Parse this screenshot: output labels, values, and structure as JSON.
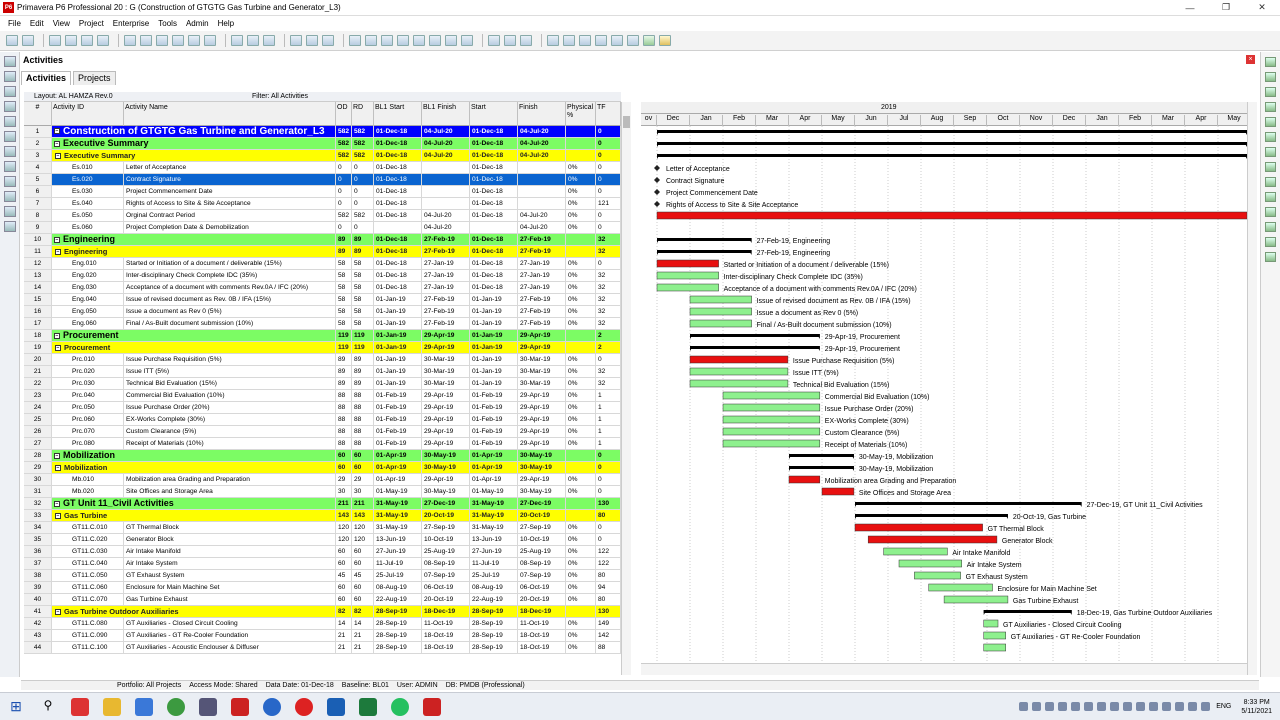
{
  "window": {
    "title": "Primavera P6 Professional 20 : G (Construction of GTGTG Gas Turbine and Generator_L3)",
    "app_icon": "P6"
  },
  "menu": [
    "File",
    "Edit",
    "View",
    "Project",
    "Enterprise",
    "Tools",
    "Admin",
    "Help"
  ],
  "panel": {
    "title": "Activities",
    "tabs": [
      "Activities",
      "Projects"
    ]
  },
  "layout_bar": {
    "layout": "Layout: AL HAMZA Rev.0",
    "filter": "Filter: All Activities"
  },
  "columns": [
    "#",
    "Activity ID",
    "Activity Name",
    "OD",
    "RD",
    "BL1 Start",
    "BL1 Finish",
    "Start",
    "Finish",
    "Physical %",
    "TF"
  ],
  "rows": [
    {
      "n": "1",
      "id": "Construction of GTGTG Gas Turbine and Generator_L3",
      "name": "",
      "od": "582",
      "rd": "582",
      "bs": "01-Dec-18",
      "bf": "04-Jul-20",
      "s": "01-Dec-18",
      "f": "04-Jul-20",
      "p": "",
      "tf": "0",
      "lvl": "lvl1"
    },
    {
      "n": "2",
      "id": "Executive Summary",
      "name": "",
      "od": "582",
      "rd": "582",
      "bs": "01-Dec-18",
      "bf": "04-Jul-20",
      "s": "01-Dec-18",
      "f": "04-Jul-20",
      "p": "",
      "tf": "0",
      "lvl": "lvl2"
    },
    {
      "n": "3",
      "id": "Executive Summary",
      "name": "",
      "od": "582",
      "rd": "582",
      "bs": "01-Dec-18",
      "bf": "04-Jul-20",
      "s": "01-Dec-18",
      "f": "04-Jul-20",
      "p": "",
      "tf": "0",
      "lvl": "lvl3"
    },
    {
      "n": "4",
      "id": "Es.010",
      "name": "Letter of Acceptance",
      "od": "0",
      "rd": "0",
      "bs": "01-Dec-18",
      "bf": "",
      "s": "01-Dec-18",
      "f": "",
      "p": "0%",
      "tf": "0",
      "lvl": "act"
    },
    {
      "n": "5",
      "id": "Es.020",
      "name": "Contract Signature",
      "od": "0",
      "rd": "0",
      "bs": "01-Dec-18",
      "bf": "",
      "s": "01-Dec-18",
      "f": "",
      "p": "0%",
      "tf": "0",
      "lvl": "sel"
    },
    {
      "n": "6",
      "id": "Es.030",
      "name": "Project Commencement Date",
      "od": "0",
      "rd": "0",
      "bs": "01-Dec-18",
      "bf": "",
      "s": "01-Dec-18",
      "f": "",
      "p": "0%",
      "tf": "0",
      "lvl": "act"
    },
    {
      "n": "7",
      "id": "Es.040",
      "name": "Rights of Access to Site & Site Acceptance",
      "od": "0",
      "rd": "0",
      "bs": "01-Dec-18",
      "bf": "",
      "s": "01-Dec-18",
      "f": "",
      "p": "0%",
      "tf": "121",
      "lvl": "act"
    },
    {
      "n": "8",
      "id": "Es.050",
      "name": "Orginal Contract Period",
      "od": "582",
      "rd": "582",
      "bs": "01-Dec-18",
      "bf": "04-Jul-20",
      "s": "01-Dec-18",
      "f": "04-Jul-20",
      "p": "0%",
      "tf": "0",
      "lvl": "act"
    },
    {
      "n": "9",
      "id": "Es.060",
      "name": "Project Completion Date & Demobilization",
      "od": "0",
      "rd": "0",
      "bs": "",
      "bf": "04-Jul-20",
      "s": "",
      "f": "04-Jul-20",
      "p": "0%",
      "tf": "0",
      "lvl": "act"
    },
    {
      "n": "10",
      "id": "Engineering",
      "name": "",
      "od": "89",
      "rd": "89",
      "bs": "01-Dec-18",
      "bf": "27-Feb-19",
      "s": "01-Dec-18",
      "f": "27-Feb-19",
      "p": "",
      "tf": "32",
      "lvl": "lvl2"
    },
    {
      "n": "11",
      "id": "Engineering",
      "name": "",
      "od": "89",
      "rd": "89",
      "bs": "01-Dec-18",
      "bf": "27-Feb-19",
      "s": "01-Dec-18",
      "f": "27-Feb-19",
      "p": "",
      "tf": "32",
      "lvl": "lvl3"
    },
    {
      "n": "12",
      "id": "Eng.010",
      "name": "Started or Initiation of a document / deliverable (15%)",
      "od": "58",
      "rd": "58",
      "bs": "01-Dec-18",
      "bf": "27-Jan-19",
      "s": "01-Dec-18",
      "f": "27-Jan-19",
      "p": "0%",
      "tf": "0",
      "lvl": "act"
    },
    {
      "n": "13",
      "id": "Eng.020",
      "name": "Inter-disciplinary Check Complete IDC (35%)",
      "od": "58",
      "rd": "58",
      "bs": "01-Dec-18",
      "bf": "27-Jan-19",
      "s": "01-Dec-18",
      "f": "27-Jan-19",
      "p": "0%",
      "tf": "32",
      "lvl": "act"
    },
    {
      "n": "14",
      "id": "Eng.030",
      "name": "Acceptance of a document with comments Rev.0A / IFC (20%)",
      "od": "58",
      "rd": "58",
      "bs": "01-Dec-18",
      "bf": "27-Jan-19",
      "s": "01-Dec-18",
      "f": "27-Jan-19",
      "p": "0%",
      "tf": "32",
      "lvl": "act"
    },
    {
      "n": "15",
      "id": "Eng.040",
      "name": "Issue of revised document as Rev. 0B / IFA (15%)",
      "od": "58",
      "rd": "58",
      "bs": "01-Jan-19",
      "bf": "27-Feb-19",
      "s": "01-Jan-19",
      "f": "27-Feb-19",
      "p": "0%",
      "tf": "32",
      "lvl": "act"
    },
    {
      "n": "16",
      "id": "Eng.050",
      "name": "Issue a document as Rev 0 (5%)",
      "od": "58",
      "rd": "58",
      "bs": "01-Jan-19",
      "bf": "27-Feb-19",
      "s": "01-Jan-19",
      "f": "27-Feb-19",
      "p": "0%",
      "tf": "32",
      "lvl": "act"
    },
    {
      "n": "17",
      "id": "Eng.060",
      "name": "Final / As-Built document submission (10%)",
      "od": "58",
      "rd": "58",
      "bs": "01-Jan-19",
      "bf": "27-Feb-19",
      "s": "01-Jan-19",
      "f": "27-Feb-19",
      "p": "0%",
      "tf": "32",
      "lvl": "act"
    },
    {
      "n": "18",
      "id": "Procurement",
      "name": "",
      "od": "119",
      "rd": "119",
      "bs": "01-Jan-19",
      "bf": "29-Apr-19",
      "s": "01-Jan-19",
      "f": "29-Apr-19",
      "p": "",
      "tf": "2",
      "lvl": "lvl2"
    },
    {
      "n": "19",
      "id": "Procurement",
      "name": "",
      "od": "119",
      "rd": "119",
      "bs": "01-Jan-19",
      "bf": "29-Apr-19",
      "s": "01-Jan-19",
      "f": "29-Apr-19",
      "p": "",
      "tf": "2",
      "lvl": "lvl3"
    },
    {
      "n": "20",
      "id": "Prc.010",
      "name": "Issue Purchase Requisition (5%)",
      "od": "89",
      "rd": "89",
      "bs": "01-Jan-19",
      "bf": "30-Mar-19",
      "s": "01-Jan-19",
      "f": "30-Mar-19",
      "p": "0%",
      "tf": "0",
      "lvl": "act"
    },
    {
      "n": "21",
      "id": "Prc.020",
      "name": "Issue ITT (5%)",
      "od": "89",
      "rd": "89",
      "bs": "01-Jan-19",
      "bf": "30-Mar-19",
      "s": "01-Jan-19",
      "f": "30-Mar-19",
      "p": "0%",
      "tf": "32",
      "lvl": "act"
    },
    {
      "n": "22",
      "id": "Prc.030",
      "name": "Technical Bid Evaluation (15%)",
      "od": "89",
      "rd": "89",
      "bs": "01-Jan-19",
      "bf": "30-Mar-19",
      "s": "01-Jan-19",
      "f": "30-Mar-19",
      "p": "0%",
      "tf": "32",
      "lvl": "act"
    },
    {
      "n": "23",
      "id": "Prc.040",
      "name": "Commercial Bid Evaluation (10%)",
      "od": "88",
      "rd": "88",
      "bs": "01-Feb-19",
      "bf": "29-Apr-19",
      "s": "01-Feb-19",
      "f": "29-Apr-19",
      "p": "0%",
      "tf": "1",
      "lvl": "act"
    },
    {
      "n": "24",
      "id": "Prc.050",
      "name": "Issue Purchase Order (20%)",
      "od": "88",
      "rd": "88",
      "bs": "01-Feb-19",
      "bf": "29-Apr-19",
      "s": "01-Feb-19",
      "f": "29-Apr-19",
      "p": "0%",
      "tf": "1",
      "lvl": "act"
    },
    {
      "n": "25",
      "id": "Prc.060",
      "name": "EX-Works Complete (30%)",
      "od": "88",
      "rd": "88",
      "bs": "01-Feb-19",
      "bf": "29-Apr-19",
      "s": "01-Feb-19",
      "f": "29-Apr-19",
      "p": "0%",
      "tf": "1",
      "lvl": "act"
    },
    {
      "n": "26",
      "id": "Prc.070",
      "name": "Custom Clearance (5%)",
      "od": "88",
      "rd": "88",
      "bs": "01-Feb-19",
      "bf": "29-Apr-19",
      "s": "01-Feb-19",
      "f": "29-Apr-19",
      "p": "0%",
      "tf": "1",
      "lvl": "act"
    },
    {
      "n": "27",
      "id": "Prc.080",
      "name": "Receipt of Materials (10%)",
      "od": "88",
      "rd": "88",
      "bs": "01-Feb-19",
      "bf": "29-Apr-19",
      "s": "01-Feb-19",
      "f": "29-Apr-19",
      "p": "0%",
      "tf": "1",
      "lvl": "act"
    },
    {
      "n": "28",
      "id": "Mobilization",
      "name": "",
      "od": "60",
      "rd": "60",
      "bs": "01-Apr-19",
      "bf": "30-May-19",
      "s": "01-Apr-19",
      "f": "30-May-19",
      "p": "",
      "tf": "0",
      "lvl": "lvl2"
    },
    {
      "n": "29",
      "id": "Mobilization",
      "name": "",
      "od": "60",
      "rd": "60",
      "bs": "01-Apr-19",
      "bf": "30-May-19",
      "s": "01-Apr-19",
      "f": "30-May-19",
      "p": "",
      "tf": "0",
      "lvl": "lvl3"
    },
    {
      "n": "30",
      "id": "Mb.010",
      "name": "Mobilization area Grading and Preparation",
      "od": "29",
      "rd": "29",
      "bs": "01-Apr-19",
      "bf": "29-Apr-19",
      "s": "01-Apr-19",
      "f": "29-Apr-19",
      "p": "0%",
      "tf": "0",
      "lvl": "act"
    },
    {
      "n": "31",
      "id": "Mb.020",
      "name": "Site Offices and Storage Area",
      "od": "30",
      "rd": "30",
      "bs": "01-May-19",
      "bf": "30-May-19",
      "s": "01-May-19",
      "f": "30-May-19",
      "p": "0%",
      "tf": "0",
      "lvl": "act"
    },
    {
      "n": "32",
      "id": "GT Unit 11_Civil Activities",
      "name": "",
      "od": "211",
      "rd": "211",
      "bs": "31-May-19",
      "bf": "27-Dec-19",
      "s": "31-May-19",
      "f": "27-Dec-19",
      "p": "",
      "tf": "130",
      "lvl": "lvl2"
    },
    {
      "n": "33",
      "id": "Gas Turbine",
      "name": "",
      "od": "143",
      "rd": "143",
      "bs": "31-May-19",
      "bf": "20-Oct-19",
      "s": "31-May-19",
      "f": "20-Oct-19",
      "p": "",
      "tf": "80",
      "lvl": "lvl3"
    },
    {
      "n": "34",
      "id": "GT11.C.010",
      "name": "GT Thermal Block",
      "od": "120",
      "rd": "120",
      "bs": "31-May-19",
      "bf": "27-Sep-19",
      "s": "31-May-19",
      "f": "27-Sep-19",
      "p": "0%",
      "tf": "0",
      "lvl": "act"
    },
    {
      "n": "35",
      "id": "GT11.C.020",
      "name": "Generator Block",
      "od": "120",
      "rd": "120",
      "bs": "13-Jun-19",
      "bf": "10-Oct-19",
      "s": "13-Jun-19",
      "f": "10-Oct-19",
      "p": "0%",
      "tf": "0",
      "lvl": "act"
    },
    {
      "n": "36",
      "id": "GT11.C.030",
      "name": "Air Intake Manifold",
      "od": "60",
      "rd": "60",
      "bs": "27-Jun-19",
      "bf": "25-Aug-19",
      "s": "27-Jun-19",
      "f": "25-Aug-19",
      "p": "0%",
      "tf": "122",
      "lvl": "act"
    },
    {
      "n": "37",
      "id": "GT11.C.040",
      "name": "Air Intake System",
      "od": "60",
      "rd": "60",
      "bs": "11-Jul-19",
      "bf": "08-Sep-19",
      "s": "11-Jul-19",
      "f": "08-Sep-19",
      "p": "0%",
      "tf": "122",
      "lvl": "act"
    },
    {
      "n": "38",
      "id": "GT11.C.050",
      "name": "GT Exhaust System",
      "od": "45",
      "rd": "45",
      "bs": "25-Jul-19",
      "bf": "07-Sep-19",
      "s": "25-Jul-19",
      "f": "07-Sep-19",
      "p": "0%",
      "tf": "80",
      "lvl": "act"
    },
    {
      "n": "39",
      "id": "GT11.C.060",
      "name": "Enclosure for Main Machine Set",
      "od": "60",
      "rd": "60",
      "bs": "08-Aug-19",
      "bf": "06-Oct-19",
      "s": "08-Aug-19",
      "f": "06-Oct-19",
      "p": "0%",
      "tf": "94",
      "lvl": "act"
    },
    {
      "n": "40",
      "id": "GT11.C.070",
      "name": "Gas Turbine Exhaust",
      "od": "60",
      "rd": "60",
      "bs": "22-Aug-19",
      "bf": "20-Oct-19",
      "s": "22-Aug-19",
      "f": "20-Oct-19",
      "p": "0%",
      "tf": "80",
      "lvl": "act"
    },
    {
      "n": "41",
      "id": "Gas Turbine Outdoor Auxiliaries",
      "name": "",
      "od": "82",
      "rd": "82",
      "bs": "28-Sep-19",
      "bf": "18-Dec-19",
      "s": "28-Sep-19",
      "f": "18-Dec-19",
      "p": "",
      "tf": "130",
      "lvl": "lvl3"
    },
    {
      "n": "42",
      "id": "GT11.C.080",
      "name": "GT Auxiliaries - Closed Circuit Cooling",
      "od": "14",
      "rd": "14",
      "bs": "28-Sep-19",
      "bf": "11-Oct-19",
      "s": "28-Sep-19",
      "f": "11-Oct-19",
      "p": "0%",
      "tf": "149",
      "lvl": "act"
    },
    {
      "n": "43",
      "id": "GT11.C.090",
      "name": "GT Auxiliaries - GT Re-Cooler Foundation",
      "od": "21",
      "rd": "21",
      "bs": "28-Sep-19",
      "bf": "18-Oct-19",
      "s": "28-Sep-19",
      "f": "18-Oct-19",
      "p": "0%",
      "tf": "142",
      "lvl": "act"
    },
    {
      "n": "44",
      "id": "GT11.C.100",
      "name": "GT Auxiliaries - Acoustic Enclouser & Diffuser",
      "od": "21",
      "rd": "21",
      "bs": "28-Sep-19",
      "bf": "18-Oct-19",
      "s": "28-Sep-19",
      "f": "18-Oct-19",
      "p": "0%",
      "tf": "88",
      "lvl": "act"
    }
  ],
  "gantt": {
    "year_label": "2019",
    "months": [
      "ov",
      "Dec",
      "Jan",
      "Feb",
      "Mar",
      "Apr",
      "May",
      "Jun",
      "Jul",
      "Aug",
      "Sep",
      "Oct",
      "Nov",
      "Dec",
      "Jan",
      "Feb",
      "Mar",
      "Apr",
      "May"
    ],
    "labels": [
      {
        "row": 4,
        "text": "Letter of Acceptance"
      },
      {
        "row": 5,
        "text": "Contract Signature"
      },
      {
        "row": 6,
        "text": "Project Commencement Date"
      },
      {
        "row": 7,
        "text": "Rights of Access to Site & Site Acceptance"
      },
      {
        "row": 10,
        "text": "27-Feb-19, Engineering"
      },
      {
        "row": 11,
        "text": "27-Feb-19, Engineering"
      },
      {
        "row": 12,
        "text": "Started or Initiation of a document / deliverable (15%)"
      },
      {
        "row": 13,
        "text": "Inter-disciplinary Check Complete IDC (35%)"
      },
      {
        "row": 14,
        "text": "Acceptance of a document with comments Rev.0A / IFC (20%)"
      },
      {
        "row": 15,
        "text": "Issue of revised document as Rev. 0B / IFA (15%)"
      },
      {
        "row": 16,
        "text": "Issue a document as Rev 0 (5%)"
      },
      {
        "row": 17,
        "text": "Final / As-Built document submission (10%)"
      },
      {
        "row": 18,
        "text": "29-Apr-19, Procurement"
      },
      {
        "row": 19,
        "text": "29-Apr-19, Procurement"
      },
      {
        "row": 20,
        "text": "Issue Purchase Requisition (5%)"
      },
      {
        "row": 21,
        "text": "Issue ITT (5%)"
      },
      {
        "row": 22,
        "text": "Technical Bid Evaluation (15%)"
      },
      {
        "row": 23,
        "text": "Commercial Bid Evaluation (10%)"
      },
      {
        "row": 24,
        "text": "Issue Purchase Order (20%)"
      },
      {
        "row": 25,
        "text": "EX-Works Complete (30%)"
      },
      {
        "row": 26,
        "text": "Custom Clearance (5%)"
      },
      {
        "row": 27,
        "text": "Receipt of Materials (10%)"
      },
      {
        "row": 28,
        "text": "30-May-19, Mobilization"
      },
      {
        "row": 29,
        "text": "30-May-19, Mobilization"
      },
      {
        "row": 30,
        "text": "Mobilization area Grading and Preparation"
      },
      {
        "row": 31,
        "text": "Site Offices and Storage Area"
      },
      {
        "row": 32,
        "text": "27-Dec-19, GT Unit 11_Civil Activities"
      },
      {
        "row": 33,
        "text": "20-Oct-19, Gas Turbine"
      },
      {
        "row": 34,
        "text": "GT Thermal Block"
      },
      {
        "row": 35,
        "text": "Generator Block"
      },
      {
        "row": 36,
        "text": "Air Intake Manifold"
      },
      {
        "row": 37,
        "text": "Air Intake System"
      },
      {
        "row": 38,
        "text": "GT Exhaust System"
      },
      {
        "row": 39,
        "text": "Enclosure for Main Machine Set"
      },
      {
        "row": 40,
        "text": "Gas Turbine Exhaust"
      },
      {
        "row": 41,
        "text": "18-Dec-19, Gas Turbine Outdoor Auxiliaries"
      },
      {
        "row": 42,
        "text": "GT Auxiliaries - Closed Circuit Cooling"
      },
      {
        "row": 43,
        "text": "GT Auxiliaries - GT Re-Cooler Foundation"
      }
    ],
    "colors": {
      "critical": "#e81010",
      "normal": "#8ef08e",
      "summary": "#000000"
    }
  },
  "status": {
    "portfolio": "Portfolio: All Projects",
    "access": "Access Mode: Shared",
    "data_date": "Data Date: 01-Dec-18",
    "baseline": "Baseline: BL01",
    "user": "User: ADMIN",
    "db": "DB: PMDB (Professional)"
  },
  "taskbar": {
    "lang": "ENG",
    "time": "8:33 PM",
    "date": "5/11/2021"
  }
}
